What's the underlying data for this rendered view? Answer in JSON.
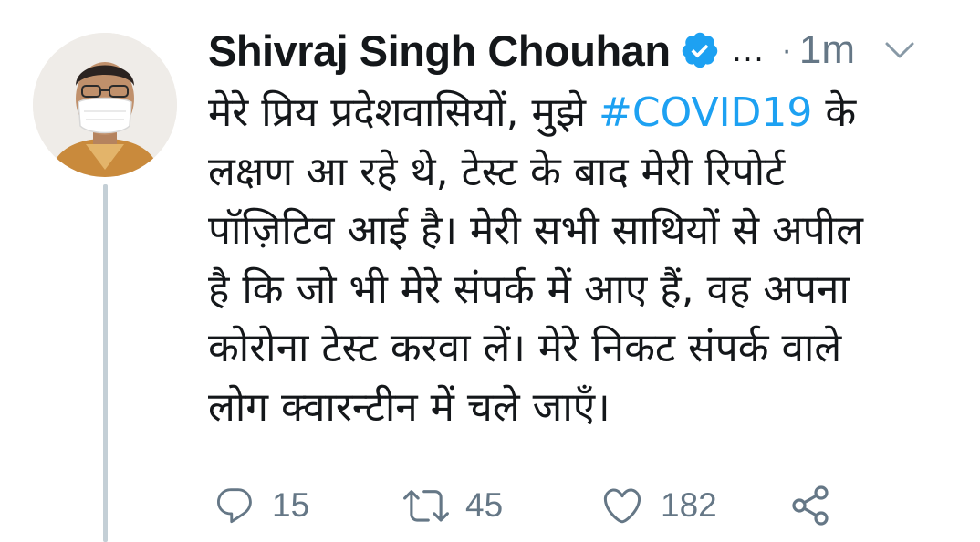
{
  "author": {
    "name": "Shivraj Singh Chouhan",
    "verified": true,
    "more_label": "...",
    "separator": "·",
    "time": "1m"
  },
  "tweet": {
    "lines": [
      {
        "before": "मेरे प्रिय प्रदेशवासियों, मुझे ",
        "hashtag": "#COVID19",
        "after": " के"
      },
      "लक्षण आ रहे थे, टेस्ट के बाद मेरी रिपोर्ट",
      "पॉज़िटिव आई है। मेरी सभी साथियों से अपील",
      "है कि जो भी मेरे संपर्क में आए हैं, वह अपना",
      "कोरोना टेस्ट करवा लें। मेरे निकट संपर्क वाले",
      "लोग क्वारन्टीन में चले जाएँ।"
    ]
  },
  "actions": {
    "replies": "15",
    "retweets": "45",
    "likes": "182"
  },
  "icons": {
    "reply": "reply-icon",
    "retweet": "retweet-icon",
    "like": "heart-icon",
    "share": "share-icon",
    "verified": "verified-badge-icon",
    "menu": "chevron-down-icon"
  },
  "colors": {
    "text": "#14171a",
    "secondary": "#657786",
    "link": "#1da1f2",
    "thread_line": "#c4cfd6"
  }
}
